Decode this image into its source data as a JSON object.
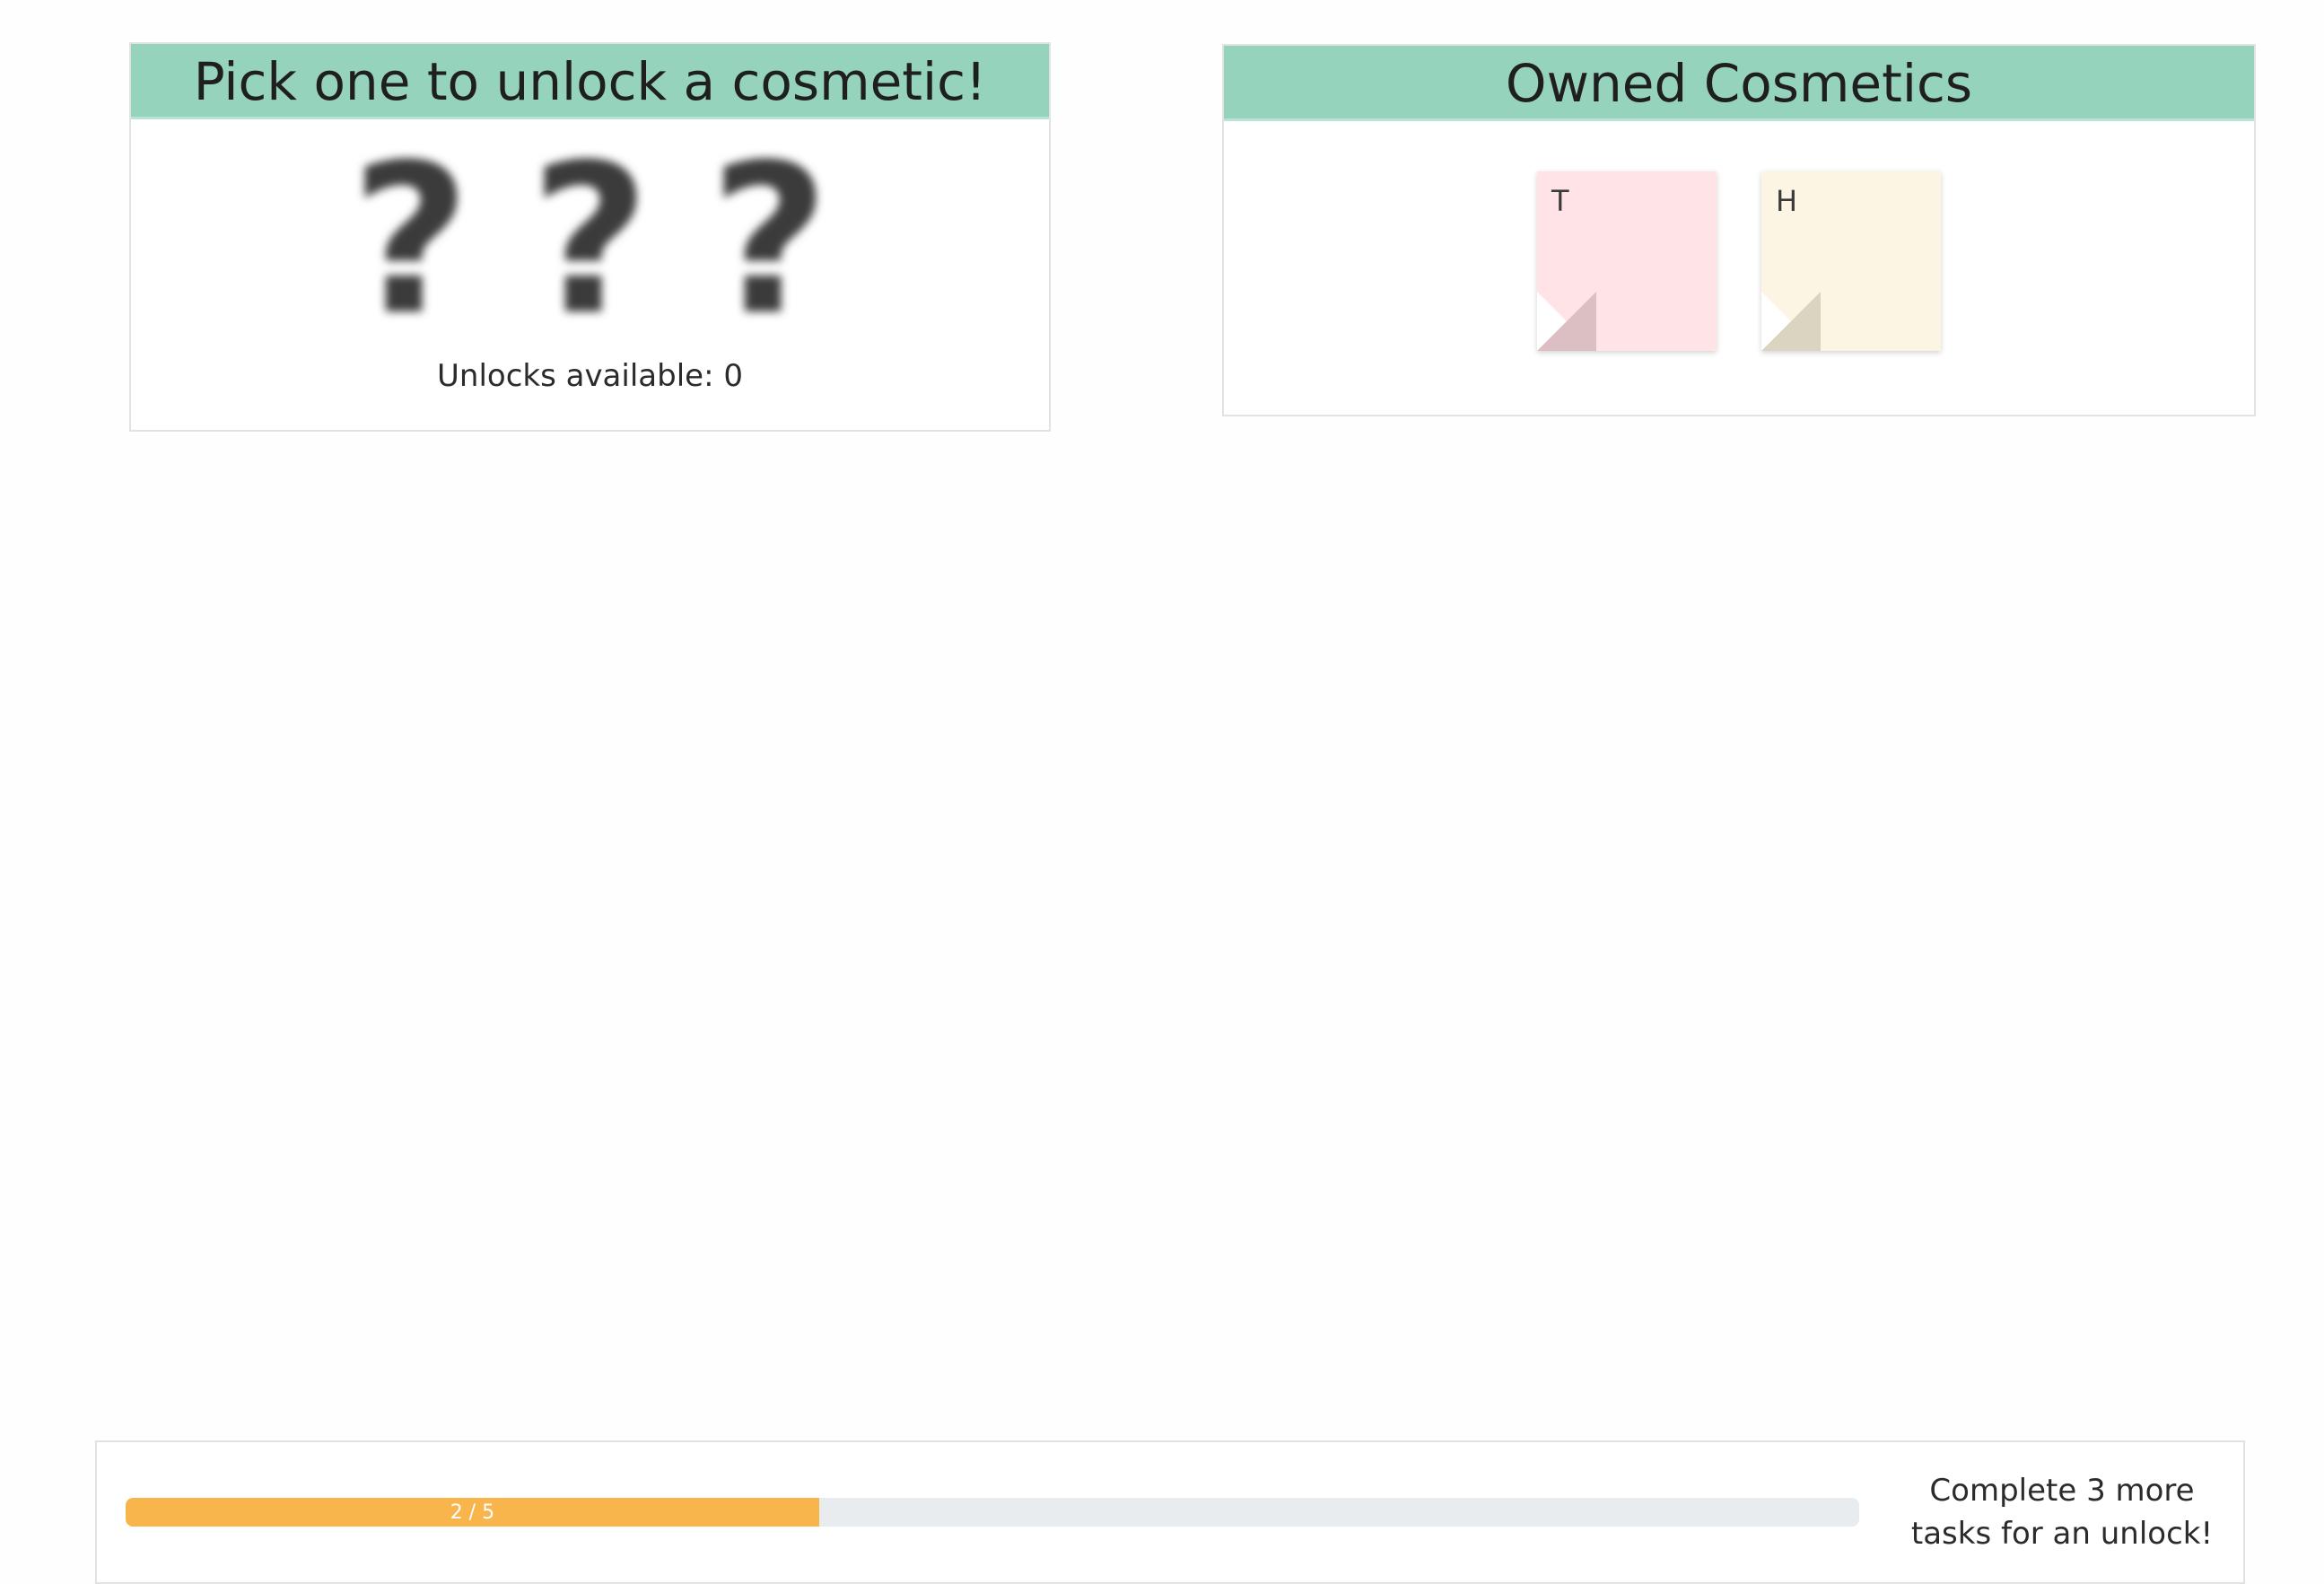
{
  "unlock_panel": {
    "title": "Pick one to unlock a cosmetic!",
    "mystery_items": [
      "?",
      "?",
      "?"
    ],
    "unlocks_text": "Unlocks available: 0"
  },
  "owned_panel": {
    "title": "Owned Cosmetics",
    "notes": [
      {
        "letter": "T",
        "color": "#ffe3e6"
      },
      {
        "letter": "H",
        "color": "#fcf5e4"
      }
    ]
  },
  "progress": {
    "label": "2 / 5",
    "completed": 2,
    "total": 5,
    "message": "Complete 3 more tasks for an unlock!",
    "fill_color": "#f8b54b"
  },
  "colors": {
    "header": "#95d3bc",
    "progress_track": "#e9ecef"
  }
}
